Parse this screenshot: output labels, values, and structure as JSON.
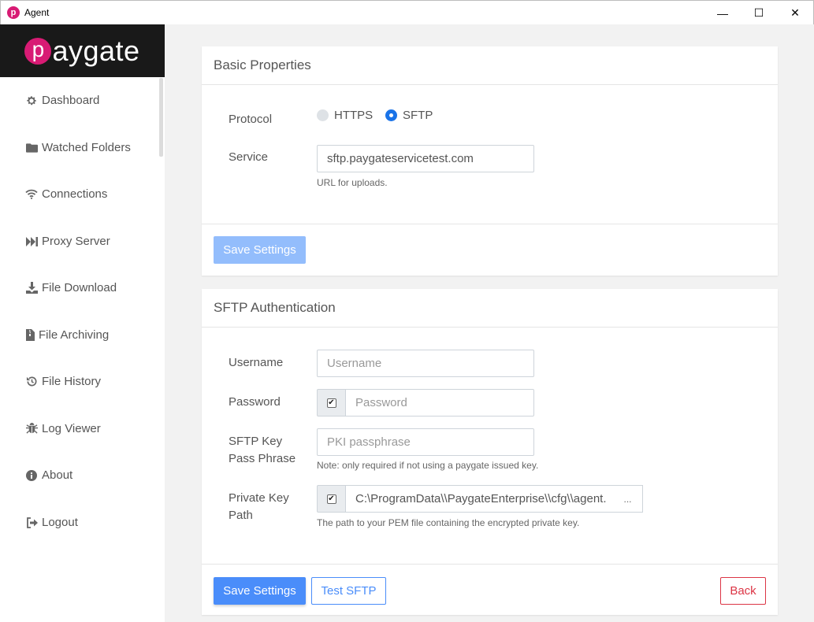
{
  "window": {
    "title": "Agent",
    "app_icon_letter": "p",
    "minimize": "—",
    "maximize": "☐",
    "close": "✕"
  },
  "logo": {
    "text": "aygate",
    "mark": "p"
  },
  "sidebar": {
    "items": [
      {
        "label": "Dashboard",
        "icon": "gear-icon"
      },
      {
        "label": "Watched Folders",
        "icon": "folder-icon"
      },
      {
        "label": "Connections",
        "icon": "wifi-icon"
      },
      {
        "label": "Proxy Server",
        "icon": "fast-forward-icon"
      },
      {
        "label": "File Download",
        "icon": "download-icon"
      },
      {
        "label": "File Archiving",
        "icon": "file-archive-icon"
      },
      {
        "label": "File History",
        "icon": "history-icon"
      },
      {
        "label": "Log Viewer",
        "icon": "bug-icon"
      },
      {
        "label": "About",
        "icon": "info-icon"
      },
      {
        "label": "Logout",
        "icon": "logout-icon"
      }
    ]
  },
  "basic": {
    "title": "Basic Properties",
    "protocol_label": "Protocol",
    "protocol_options": [
      "HTTPS",
      "SFTP"
    ],
    "protocol_selected": "SFTP",
    "service_label": "Service",
    "service_value": "sftp.paygateservicetest.com",
    "service_help": "URL for uploads.",
    "save_label": "Save Settings"
  },
  "sftp": {
    "title": "SFTP Authentication",
    "username_label": "Username",
    "username_placeholder": "Username",
    "password_label": "Password",
    "password_placeholder": "Password",
    "keyphrase_label_1": "SFTP Key",
    "keyphrase_label_2": "Pass Phrase",
    "keyphrase_placeholder": "PKI passphrase",
    "keyphrase_help": "Note: only required if not using a paygate issued key.",
    "keypath_label_1": "Private Key",
    "keypath_label_2": "Path",
    "keypath_value": "C:\\ProgramData\\\\PaygateEnterprise\\\\cfg\\\\agent.",
    "keypath_browse": "...",
    "keypath_help": "The path to your PEM file containing the encrypted private key.",
    "save_label": "Save Settings",
    "test_label": "Test SFTP",
    "back_label": "Back"
  },
  "colors": {
    "accent": "#4a8dfa",
    "brand": "#d81b74",
    "danger": "#dc3545"
  }
}
